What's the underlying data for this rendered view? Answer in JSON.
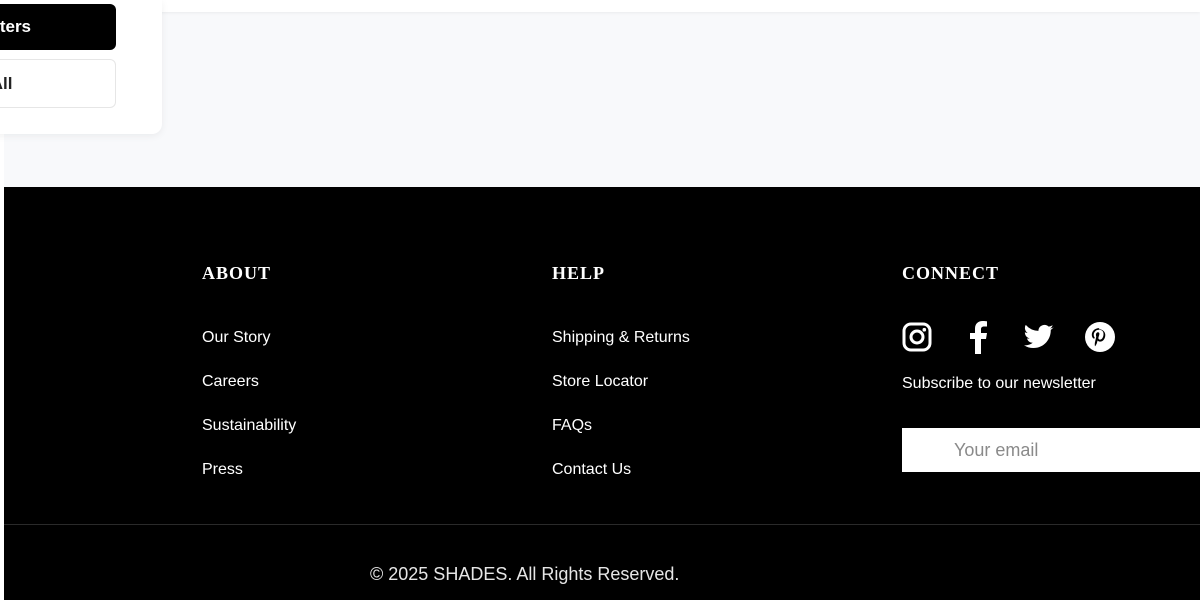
{
  "filters": {
    "apply_label": "Filters",
    "reset_label": "t All"
  },
  "footer": {
    "about": {
      "title": "ABOUT",
      "links": [
        "Our Story",
        "Careers",
        "Sustainability",
        "Press"
      ]
    },
    "help": {
      "title": "HELP",
      "links": [
        "Shipping & Returns",
        "Store Locator",
        "FAQs",
        "Contact Us"
      ]
    },
    "connect": {
      "title": "CONNECT",
      "social_icons": [
        "instagram-icon",
        "facebook-icon",
        "twitter-icon",
        "pinterest-icon"
      ],
      "newsletter_label": "Subscribe to our newsletter",
      "email_placeholder": "Your email"
    },
    "copyright": "© 2025 SHADES. All Rights Reserved."
  }
}
